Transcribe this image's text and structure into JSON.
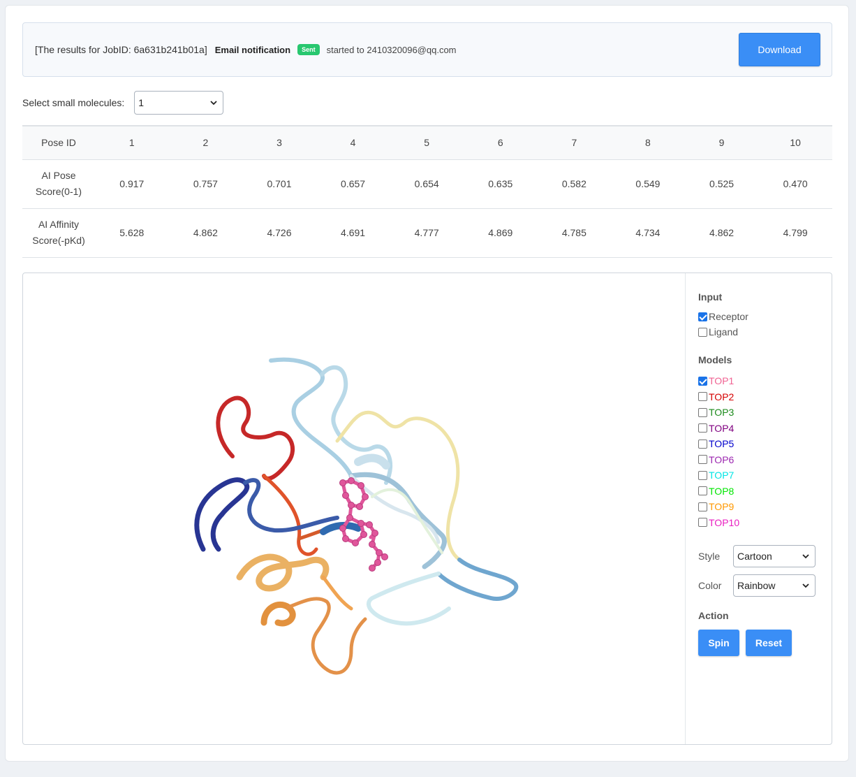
{
  "job": {
    "results_text": "[The results for JobID: 6a631b241b01a]",
    "email_label": "Email notification",
    "badge": "Sent",
    "email_rest": "started to 2410320096@qq.com",
    "download_label": "Download"
  },
  "molecule_select": {
    "label": "Select small molecules:",
    "value": "1"
  },
  "table": {
    "header_label": "Pose ID",
    "pose_ids": [
      "1",
      "2",
      "3",
      "4",
      "5",
      "6",
      "7",
      "8",
      "9",
      "10"
    ],
    "rows": [
      {
        "label_l1": "AI Pose",
        "label_l2": "Score(0-1)",
        "values": [
          "0.917",
          "0.757",
          "0.701",
          "0.657",
          "0.654",
          "0.635",
          "0.582",
          "0.549",
          "0.525",
          "0.470"
        ]
      },
      {
        "label_l1": "AI Affinity",
        "label_l2": "Score(-pKd)",
        "values": [
          "5.628",
          "4.862",
          "4.726",
          "4.691",
          "4.777",
          "4.869",
          "4.785",
          "4.734",
          "4.862",
          "4.799"
        ]
      }
    ]
  },
  "panel": {
    "input_title": "Input",
    "receptor": "Receptor",
    "ligand": "Ligand",
    "models_title": "Models",
    "models": [
      {
        "label": "TOP1",
        "color": "#f06292",
        "checked": true
      },
      {
        "label": "TOP2",
        "color": "#d50000",
        "checked": false
      },
      {
        "label": "TOP3",
        "color": "#1b8a1b",
        "checked": false
      },
      {
        "label": "TOP4",
        "color": "#800080",
        "checked": false
      },
      {
        "label": "TOP5",
        "color": "#0000cc",
        "checked": false
      },
      {
        "label": "TOP6",
        "color": "#9c27b0",
        "checked": false
      },
      {
        "label": "TOP7",
        "color": "#00e5e5",
        "checked": false
      },
      {
        "label": "TOP8",
        "color": "#00e600",
        "checked": false
      },
      {
        "label": "TOP9",
        "color": "#ff9800",
        "checked": false
      },
      {
        "label": "TOP10",
        "color": "#e91ec0",
        "checked": false
      }
    ],
    "style_label": "Style",
    "style_value": "Cartoon",
    "color_label": "Color",
    "color_value": "Rainbow",
    "action_title": "Action",
    "spin_label": "Spin",
    "reset_label": "Reset"
  }
}
